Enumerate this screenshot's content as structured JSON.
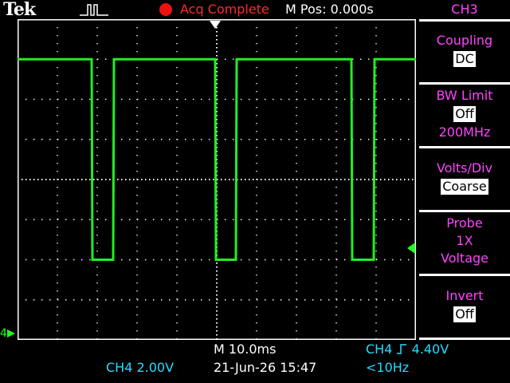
{
  "header": {
    "brand": "Tek",
    "acquisition_status": "Acq Complete",
    "menu_position": "M Pos: 0.000s",
    "acq_color": "#ee1111"
  },
  "menu": {
    "channel": "CH3",
    "coupling": {
      "label": "Coupling",
      "value": "DC"
    },
    "bw_limit": {
      "label": "BW Limit",
      "value": "Off",
      "sub": "200MHz"
    },
    "volts_div": {
      "label": "Volts/Div",
      "value": "Coarse"
    },
    "probe": {
      "label": "Probe",
      "value": "1X",
      "sub": "Voltage"
    },
    "invert": {
      "label": "Invert",
      "value": "Off"
    }
  },
  "status_bar": {
    "timebase": "M 10.0ms",
    "trigger": "CH4 ̸̲ 4.40V",
    "trigger_source": "CH4",
    "trigger_level": "4.40V",
    "channel_scale": "CH4  2.00V",
    "datetime": "21-Jun-26 15:47",
    "frequency": "<10Hz"
  },
  "ground_marker": "4",
  "colors": {
    "trace": "#22ee22",
    "grid": "#ffffff",
    "menu_text": "#ff44ff",
    "status_cyan": "#22ddff"
  },
  "chart_data": {
    "type": "line",
    "series": [
      {
        "name": "CH4",
        "x": [
          0,
          9.3,
          9.4,
          12.0,
          12.1,
          24.8,
          24.9,
          27.4,
          27.5,
          41.9,
          42.0,
          44.7,
          44.8,
          50
        ],
        "y": [
          3.0,
          3.0,
          -2.0,
          -2.0,
          3.0,
          3.0,
          -2.0,
          -2.0,
          3.0,
          3.0,
          -2.0,
          -2.0,
          3.0,
          3.0
        ]
      }
    ],
    "xlim": [
      0,
      50
    ],
    "ylim": [
      -4,
      4
    ],
    "grid": true
  }
}
